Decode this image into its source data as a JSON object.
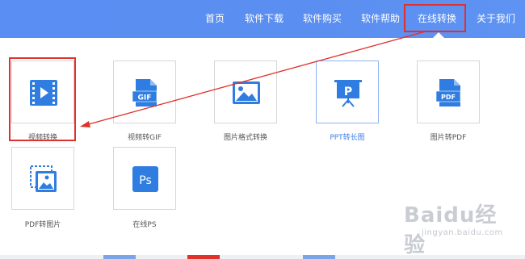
{
  "nav": {
    "items": [
      {
        "label": "首页"
      },
      {
        "label": "软件下载"
      },
      {
        "label": "软件购买"
      },
      {
        "label": "软件帮助"
      },
      {
        "label": "在线转换"
      },
      {
        "label": "关于我们"
      }
    ]
  },
  "tools": [
    {
      "label": "视频转换",
      "icon": "video-play-icon"
    },
    {
      "label": "视频转GIF",
      "icon": "gif-file-icon",
      "icon_text": "GIF"
    },
    {
      "label": "图片格式转换",
      "icon": "picture-icon"
    },
    {
      "label": "PPT转长图",
      "icon": "ppt-presentation-icon",
      "icon_text": "P"
    },
    {
      "label": "图片转PDF",
      "icon": "pdf-file-icon",
      "icon_text": "PDF"
    },
    {
      "label": "PDF转图片",
      "icon": "pdf-to-image-icon"
    },
    {
      "label": "在线PS",
      "icon": "photoshop-icon",
      "icon_text": "Ps"
    }
  ],
  "watermark": {
    "brand": "Baidu经验",
    "url": "jingyan.baidu.com"
  },
  "colors": {
    "nav_bg": "#5b8ef2",
    "icon_blue": "#2f7de1",
    "annotation_red": "#e0312d",
    "active_label": "#3f7ee8"
  }
}
